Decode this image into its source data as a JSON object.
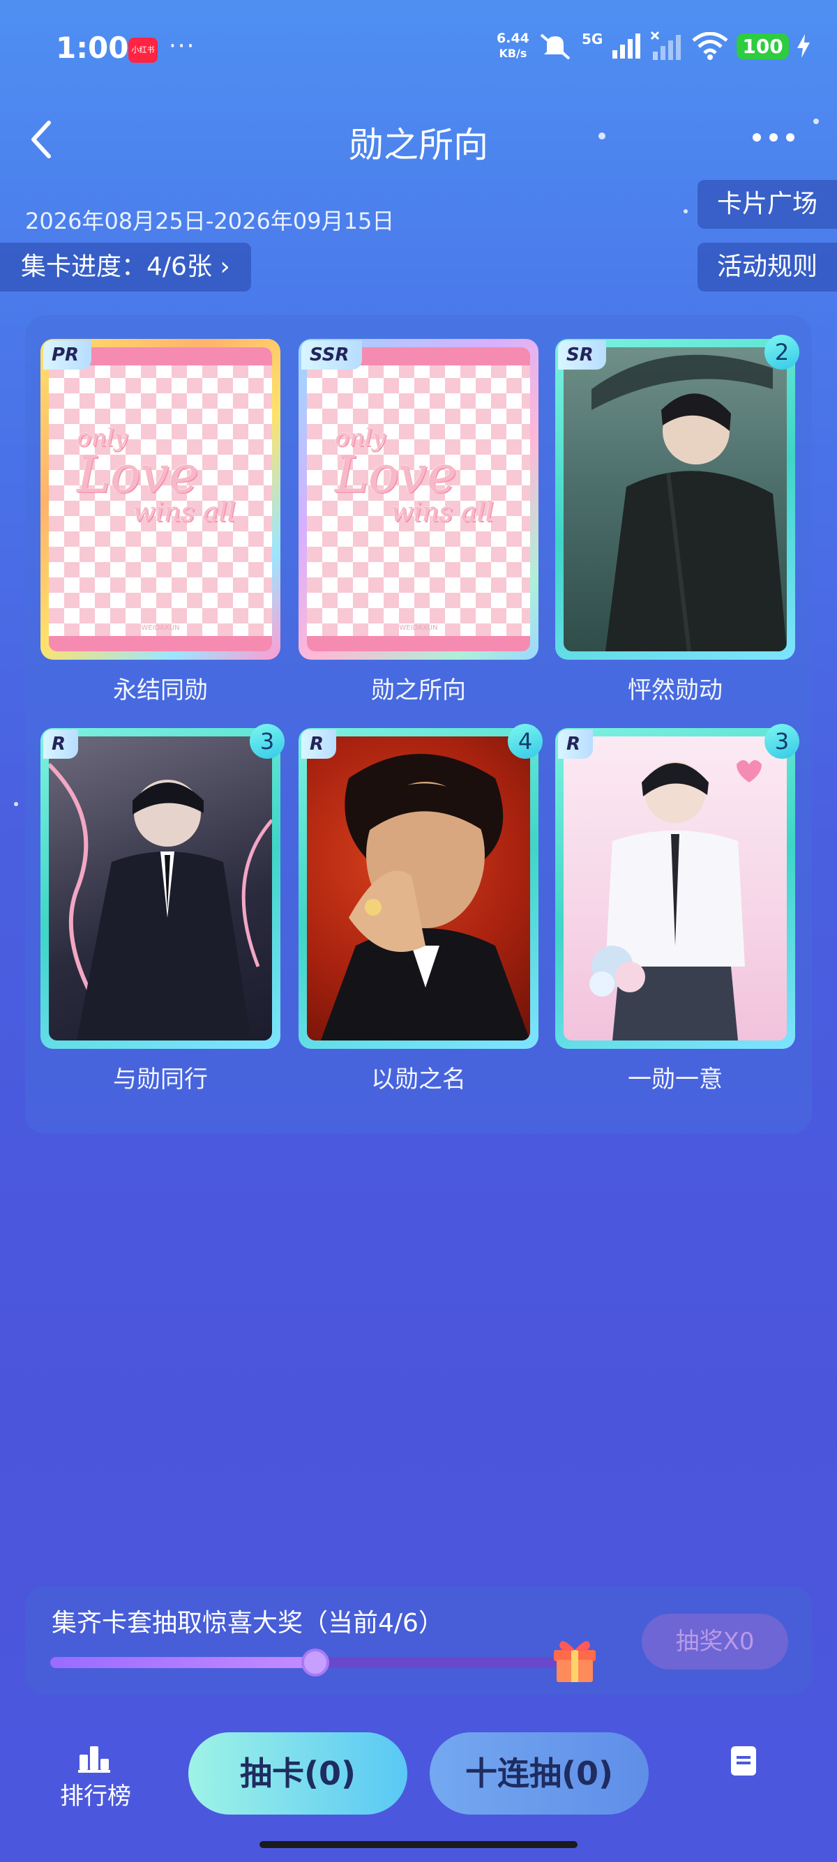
{
  "status_bar": {
    "time": "1:00",
    "app_badge": "小红书",
    "more_dots": "···",
    "net_speed_value": "6.44",
    "net_speed_unit": "KB/s",
    "network": "5G",
    "battery": "100"
  },
  "header": {
    "title": "勋之所向",
    "back_icon": "chevron-left-icon",
    "more_icon": "more-dots-icon"
  },
  "event": {
    "date_range": "2026年08月25日-2026年09月15日",
    "progress_label": "集卡进度：4/6张 ›",
    "card_plaza": "卡片广场",
    "rules": "活动规则"
  },
  "cards": [
    {
      "name": "永结同勋",
      "tier": "PR",
      "count": "",
      "owned": false,
      "frame": "gold"
    },
    {
      "name": "勋之所向",
      "tier": "SSR",
      "count": "",
      "owned": false,
      "frame": "rainbow"
    },
    {
      "name": "怦然勋动",
      "tier": "SR",
      "count": "2",
      "owned": true,
      "frame": "teal"
    },
    {
      "name": "与勋同行",
      "tier": "R",
      "count": "3",
      "owned": true,
      "frame": "teal"
    },
    {
      "name": "以勋之名",
      "tier": "R",
      "count": "4",
      "owned": true,
      "frame": "teal"
    },
    {
      "name": "一勋一意",
      "tier": "R",
      "count": "3",
      "owned": true,
      "frame": "teal"
    }
  ],
  "placeholder_art": {
    "line1": "only",
    "line2": "Love",
    "line3": "wins all",
    "watermark": "WEIDAXUN"
  },
  "prize": {
    "text": "集齐卡套抽取惊喜大奖（当前4/6）",
    "progress_fraction": 0.667,
    "lottery_label": "抽奖X0"
  },
  "bottom_bar": {
    "rank_label": "排行榜",
    "draw_label": "抽卡(0)",
    "draw10_label": "十连抽(0)"
  },
  "colors": {
    "accent_teal": "#3fd5c7",
    "bg_blue": "#4a5fe0",
    "checker_pink": "#f8c8d4"
  }
}
